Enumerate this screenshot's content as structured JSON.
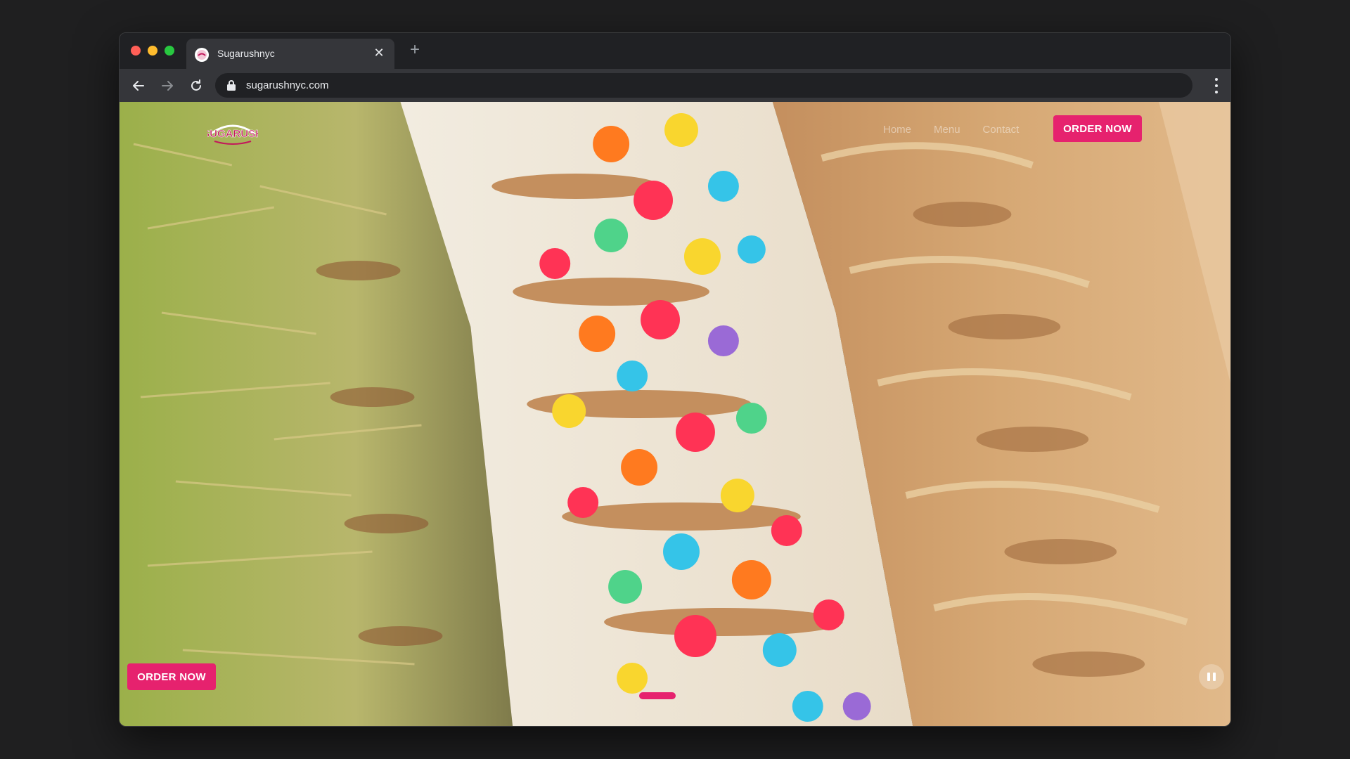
{
  "browser": {
    "tab": {
      "title": "Sugarushnyc",
      "favicon": "sugarush-logo-icon",
      "close_icon": "close-icon"
    },
    "new_tab_icon": "plus-icon",
    "toolbar": {
      "back_icon": "arrow-left-icon",
      "forward_icon": "arrow-right-icon",
      "reload_icon": "reload-icon",
      "lock_icon": "lock-icon",
      "url": "sugarushnyc.com",
      "menu_icon": "kebab-menu-icon"
    }
  },
  "site": {
    "logo_text": "SUGARUSH",
    "nav": [
      {
        "label": "Home"
      },
      {
        "label": "Menu"
      },
      {
        "label": "Contact"
      }
    ],
    "order_now_header": "ORDER NOW",
    "order_now_footer": "ORDER NOW",
    "pause_icon": "pause-icon",
    "brand_color": "#e6226e"
  }
}
